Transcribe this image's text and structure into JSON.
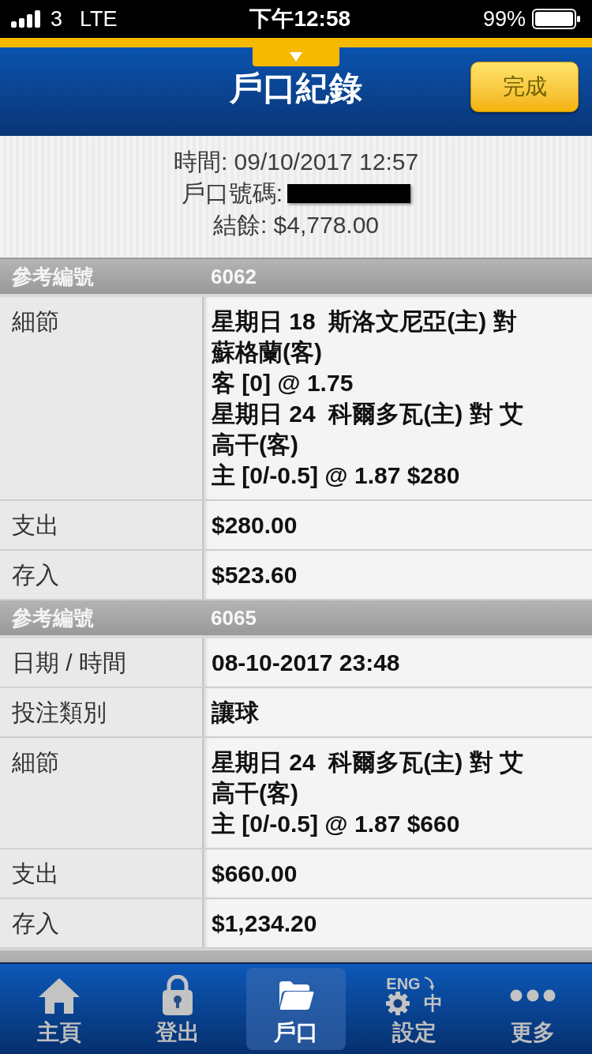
{
  "status_bar": {
    "carrier": "3",
    "network": "LTE",
    "time": "下午12:58",
    "battery": "99%"
  },
  "header": {
    "title": "戶口紀錄",
    "done_button": "完成"
  },
  "summary": {
    "time": "時間: 09/10/2017 12:57",
    "account_label": "戶口號碼:",
    "account_redacted": true,
    "balance": "結餘: $4,778.00"
  },
  "records": [
    {
      "kind": "full",
      "ref_label": "參考編號",
      "ref": "6062",
      "fields": [
        {
          "label": "細節",
          "lines": [
            "星期日 18  斯洛文尼亞(主) 對",
            "蘇格蘭(客)",
            "客 [0] @ 1.75",
            "星期日 24  科爾多瓦(主) 對 艾",
            "高干(客)",
            "主 [0/-0.5] @ 1.87 $280"
          ]
        },
        {
          "label": "支出",
          "lines": [
            "$280.00"
          ]
        },
        {
          "label": "存入",
          "lines": [
            "$523.60"
          ]
        }
      ]
    },
    {
      "kind": "full",
      "ref_label": "參考編號",
      "ref": "6065",
      "fields": [
        {
          "label": "日期 / 時間",
          "lines": [
            "08-10-2017 23:48"
          ]
        },
        {
          "label": "投注類別",
          "lines": [
            "讓球"
          ]
        },
        {
          "label": "細節",
          "lines": [
            "星期日 24  科爾多瓦(主) 對 艾",
            "高干(客)",
            "主 [0/-0.5] @ 1.87 $660"
          ]
        },
        {
          "label": "支出",
          "lines": [
            "$660.00"
          ]
        },
        {
          "label": "存入",
          "lines": [
            "$1,234.20"
          ]
        }
      ]
    },
    {
      "kind": "cut_off"
    }
  ],
  "tabs": [
    {
      "label": "主頁",
      "selected": false
    },
    {
      "label": "登出",
      "selected": false
    },
    {
      "label": "戶口",
      "selected": true
    },
    {
      "label": "設定",
      "selected": false,
      "icon_texts": [
        "ENG",
        "中"
      ]
    },
    {
      "label": "更多",
      "selected": false
    }
  ]
}
